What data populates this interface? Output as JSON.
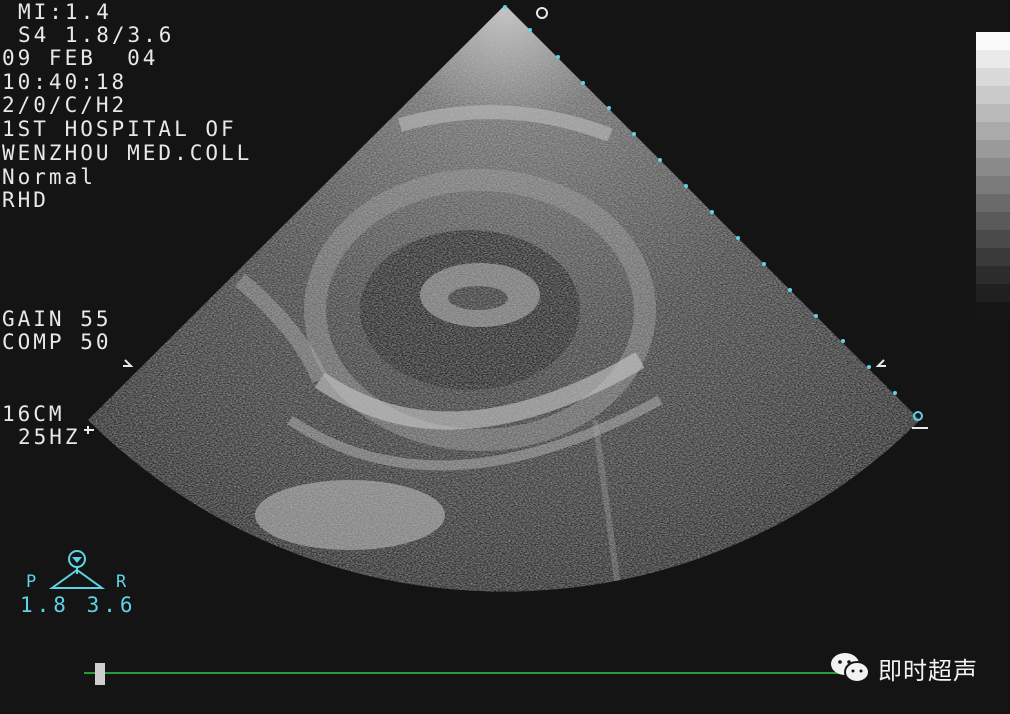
{
  "header": {
    "mi": "MI:1.4",
    "probe": "S4 1.8/3.6",
    "date": "09 FEB  04",
    "time": "10:40:18",
    "mode": "2/0/C/H2",
    "institution_line1": "1ST HOSPITAL OF",
    "institution_line2": "WENZHOU MED.COLL",
    "preset": "Normal",
    "orientation": "RHD"
  },
  "settings": {
    "gain": "GAIN 55",
    "comp": "COMP 50",
    "depth": "16CM",
    "frame_rate": "25HZ"
  },
  "probe_indicator": {
    "left_label": "P",
    "right_label": "R",
    "values": "1.8 3.6"
  },
  "watermark": {
    "text": "即时超声",
    "icon": "wechat-icon"
  },
  "colors": {
    "background": "#141414",
    "text": "#e8e8e8",
    "accent_cyan": "#5fd3e6",
    "timeline": "#2a9a3a"
  }
}
